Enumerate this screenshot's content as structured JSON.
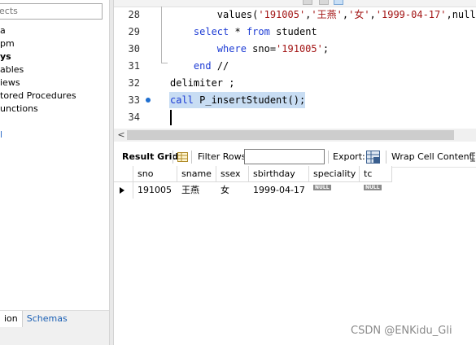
{
  "navigator": {
    "search_placeholder": "ects",
    "items": [
      {
        "label": "a",
        "bold": false
      },
      {
        "label": "pm",
        "bold": false
      },
      {
        "label": "ys",
        "bold": true
      },
      {
        "label": "ables",
        "bold": false
      },
      {
        "label": "iews",
        "bold": false
      },
      {
        "label": "tored Procedures",
        "bold": false
      },
      {
        "label": "unctions",
        "bold": false
      },
      {
        "label": "",
        "bold": false
      },
      {
        "label": "l",
        "bold": false
      }
    ],
    "tabs": [
      {
        "label": "ion",
        "active": true
      },
      {
        "label": "Schemas",
        "active": false
      }
    ]
  },
  "editor": {
    "line_numbers": [
      "28",
      "29",
      "30",
      "31",
      "32",
      "33",
      "34"
    ],
    "breakpoint_line": "33",
    "lines": [
      {
        "indent": "        ",
        "tokens": [
          {
            "t": "values(",
            "c": "plain"
          },
          {
            "t": "'191005'",
            "c": "str"
          },
          {
            "t": ",",
            "c": "plain"
          },
          {
            "t": "'王燕'",
            "c": "str"
          },
          {
            "t": ",",
            "c": "plain"
          },
          {
            "t": "'女'",
            "c": "str"
          },
          {
            "t": ",",
            "c": "plain"
          },
          {
            "t": "'1999-04-17'",
            "c": "str"
          },
          {
            "t": ",null,",
            "c": "plain"
          }
        ]
      },
      {
        "indent": "    ",
        "tokens": [
          {
            "t": "select",
            "c": "kw"
          },
          {
            "t": " * ",
            "c": "plain"
          },
          {
            "t": "from",
            "c": "kw"
          },
          {
            "t": " student",
            "c": "plain"
          }
        ]
      },
      {
        "indent": "        ",
        "tokens": [
          {
            "t": "where",
            "c": "kw"
          },
          {
            "t": " sno=",
            "c": "plain"
          },
          {
            "t": "'191005'",
            "c": "str"
          },
          {
            "t": ";",
            "c": "plain"
          }
        ]
      },
      {
        "indent": "    ",
        "tokens": [
          {
            "t": "end",
            "c": "kw"
          },
          {
            "t": " //",
            "c": "plain"
          }
        ]
      },
      {
        "indent": "",
        "tokens": [
          {
            "t": "delimiter ;",
            "c": "plain"
          }
        ]
      },
      {
        "indent": "",
        "tokens": [
          {
            "t": "call",
            "c": "kw"
          },
          {
            "t": " P_insertStudent();",
            "c": "plain"
          }
        ]
      },
      {
        "indent": "",
        "tokens": []
      }
    ]
  },
  "result_toolbar": {
    "result_grid_label": "Result Grid",
    "filter_rows_label": "Filter Rows:",
    "filter_value": "",
    "export_label": "Export:",
    "wrap_label": "Wrap Cell Content:"
  },
  "result_grid": {
    "columns": [
      "sno",
      "sname",
      "ssex",
      "sbirthday",
      "speciality",
      "tc"
    ],
    "rows": [
      [
        "191005",
        "王燕",
        "女",
        "1999-04-17",
        "NULL",
        "NULL"
      ]
    ]
  },
  "colors": {
    "keyword": "#1c3bd4",
    "string": "#a31515",
    "selection": "#c8ddf3",
    "breakpoint": "#1f6fd0"
  },
  "watermark": "CSDN @ENKidu_Gli"
}
